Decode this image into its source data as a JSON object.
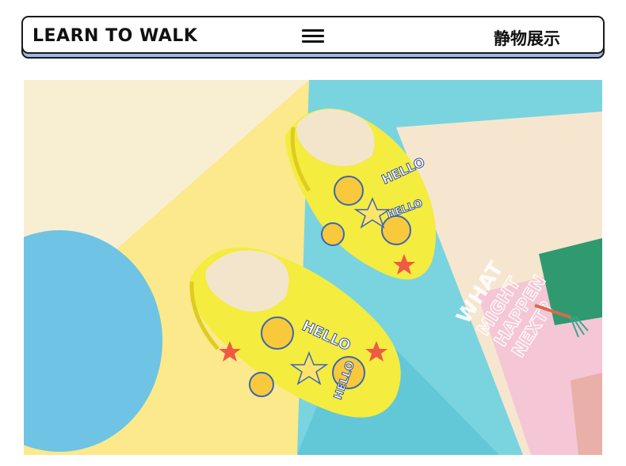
{
  "header": {
    "brand": "LEARN TO WALK",
    "menu_icon": "hamburger-menu-icon",
    "section_title": "静物展示"
  },
  "photo": {
    "shoe_print_text": "HELLO",
    "card_text": [
      "WHAT",
      "MIGHT",
      "HAPPEN",
      "NEXT?"
    ],
    "colors": {
      "background_yellow": "#fbe98a",
      "background_cream": "#f8f1d8",
      "background_cyan": "#78d3df",
      "circle_blue": "#6fc3e4",
      "slipper_yellow": "#f4ec3f",
      "lining_cream": "#f5ead8",
      "card_cream": "#f7e6cf",
      "card_pink": "#f4c6d6",
      "card_green": "#2f9a70"
    }
  }
}
